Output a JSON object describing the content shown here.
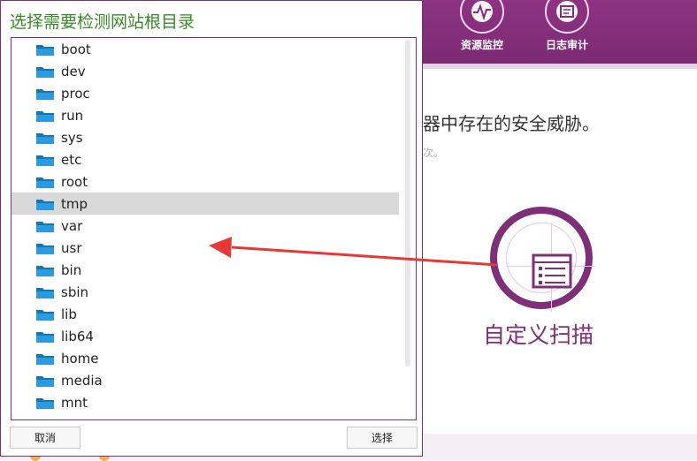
{
  "dialog": {
    "title": "选择需要检测网站根目录",
    "folders": [
      {
        "name": "boot",
        "selected": false
      },
      {
        "name": "dev",
        "selected": false
      },
      {
        "name": "proc",
        "selected": false
      },
      {
        "name": "run",
        "selected": false
      },
      {
        "name": "sys",
        "selected": false
      },
      {
        "name": "etc",
        "selected": false
      },
      {
        "name": "root",
        "selected": false
      },
      {
        "name": "tmp",
        "selected": true
      },
      {
        "name": "var",
        "selected": false
      },
      {
        "name": "usr",
        "selected": false
      },
      {
        "name": "bin",
        "selected": false
      },
      {
        "name": "sbin",
        "selected": false
      },
      {
        "name": "lib",
        "selected": false
      },
      {
        "name": "lib64",
        "selected": false
      },
      {
        "name": "home",
        "selected": false
      },
      {
        "name": "media",
        "selected": false
      },
      {
        "name": "mnt",
        "selected": false
      }
    ],
    "cancel_label": "取消",
    "choose_label": "选择"
  },
  "background": {
    "nav": [
      {
        "label": "资源监控",
        "icon": "heartbeat-icon"
      },
      {
        "label": "日志审计",
        "icon": "log-audit-icon"
      }
    ],
    "description": "器中存在的安全威胁。",
    "description_sub": "次。",
    "custom_scan_label": "自定义扫描"
  },
  "colors": {
    "brand": "#7e2f78",
    "title_green": "#3a8a2a",
    "folder_blue": "#1e8fd0",
    "arrow_red": "#e53935",
    "selected_row": "#d9d9d9"
  }
}
